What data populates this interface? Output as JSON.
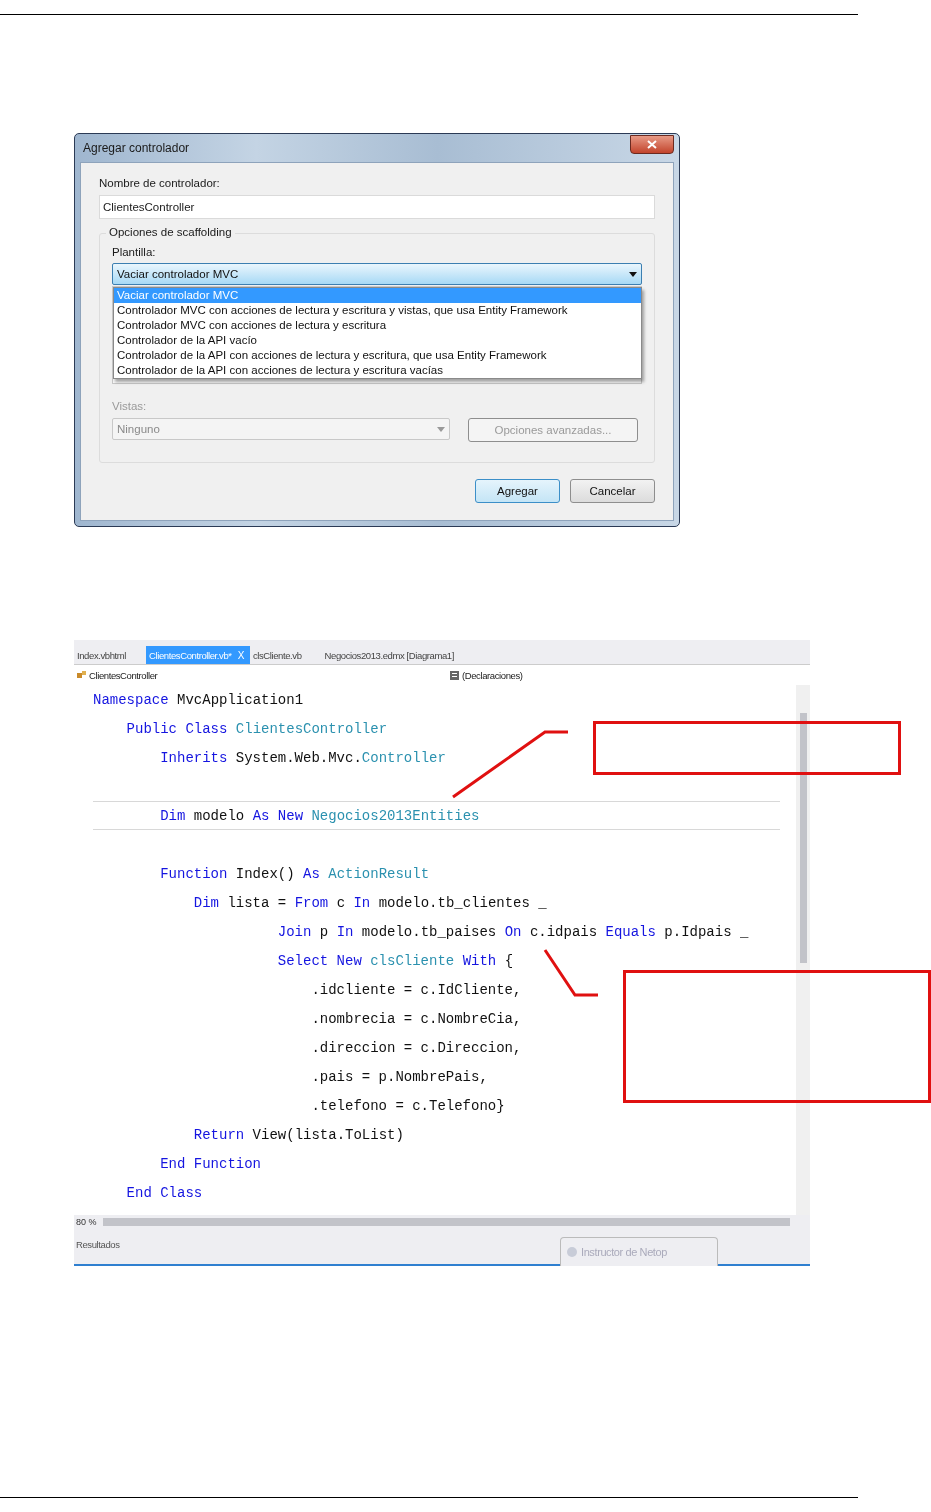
{
  "dialog": {
    "title": "Agregar controlador",
    "name_label": "Nombre de controlador:",
    "name_value": "ClientesController",
    "group_title": "Opciones de scaffolding",
    "template_label": "Plantilla:",
    "template_value": "Vaciar controlador MVC",
    "template_options": [
      {
        "label": "Vaciar controlador MVC",
        "selected": true
      },
      {
        "label": "Controlador MVC con acciones de lectura y escritura y vistas, que usa Entity Framework",
        "selected": false
      },
      {
        "label": "Controlador MVC con acciones de lectura y escritura",
        "selected": false
      },
      {
        "label": "Controlador de la API vacío",
        "selected": false
      },
      {
        "label": "Controlador de la API con acciones de lectura y escritura, que usa Entity Framework",
        "selected": false
      },
      {
        "label": "Controlador de la API con acciones de lectura y escritura vacías",
        "selected": false
      }
    ],
    "views_label": "Vistas:",
    "views_value": "Ninguno",
    "views_disabled": true,
    "advanced_button": {
      "label": "Opciones avanzadas...",
      "disabled": true
    },
    "buttons": [
      {
        "label": "Agregar",
        "default": true
      },
      {
        "label": "Cancelar",
        "default": false
      }
    ]
  },
  "editor": {
    "tabs": [
      {
        "label": "Index.vbhtml",
        "selected": false
      },
      {
        "label": "ClientesController.vb*",
        "selected": true,
        "close": "X"
      },
      {
        "label": "clsCliente.vb",
        "selected": false
      },
      {
        "label": "Negocios2013.edmx [Diagrama1]",
        "selected": false
      }
    ],
    "class_dropdown": "ClientesController",
    "member_dropdown": "(Declaraciones)",
    "code": [
      {
        "highlighted": false,
        "tokens": [
          {
            "kind": "kw",
            "text": "Namespace"
          },
          {
            "kind": "plain",
            "text": " MvcApplication1"
          }
        ],
        "children": [
          {
            "highlighted": false,
            "tokens": [
              {
                "kind": "kw",
                "text": "Public Class"
              },
              {
                "kind": "type",
                "text": " ClientesController"
              }
            ],
            "children": [
              {
                "highlighted": false,
                "tokens": [
                  {
                    "kind": "kw",
                    "text": "Inherits"
                  },
                  {
                    "kind": "plain",
                    "text": " System.Web.Mvc."
                  },
                  {
                    "kind": "type",
                    "text": "Controller"
                  }
                ]
              },
              {
                "highlighted": false
              },
              {
                "highlighted": true,
                "tokens": [
                  {
                    "kind": "kw",
                    "text": "Dim"
                  },
                  {
                    "kind": "plain",
                    "text": " modelo "
                  },
                  {
                    "kind": "kw",
                    "text": "As New"
                  },
                  {
                    "kind": "type",
                    "text": " Negocios2013Entities"
                  }
                ]
              },
              {
                "highlighted": false
              },
              {
                "highlighted": false,
                "tokens": [
                  {
                    "kind": "kw",
                    "text": "Function"
                  },
                  {
                    "kind": "plain",
                    "text": " Index() "
                  },
                  {
                    "kind": "kw",
                    "text": "As"
                  },
                  {
                    "kind": "type",
                    "text": " ActionResult"
                  }
                ],
                "children": [
                  {
                    "highlighted": false,
                    "tokens": [
                      {
                        "kind": "kw",
                        "text": "Dim"
                      },
                      {
                        "kind": "plain",
                        "text": " lista = "
                      },
                      {
                        "kind": "kw",
                        "text": "From"
                      },
                      {
                        "kind": "plain",
                        "text": " c "
                      },
                      {
                        "kind": "kw",
                        "text": "In"
                      },
                      {
                        "kind": "plain",
                        "text": " modelo.tb_clientes _"
                      }
                    ],
                    "children": [
                      {
                        "highlighted": false,
                        "tokens": [
                          {
                            "kind": "kw",
                            "text": "Join"
                          },
                          {
                            "kind": "plain",
                            "text": " p "
                          },
                          {
                            "kind": "kw",
                            "text": "In"
                          },
                          {
                            "kind": "plain",
                            "text": " modelo.tb_paises "
                          },
                          {
                            "kind": "kw",
                            "text": "On"
                          },
                          {
                            "kind": "plain",
                            "text": " c.idpais "
                          },
                          {
                            "kind": "kw",
                            "text": "Equals"
                          },
                          {
                            "kind": "plain",
                            "text": " p.Idpais _"
                          }
                        ]
                      },
                      {
                        "highlighted": false,
                        "tokens": [
                          {
                            "kind": "kw",
                            "text": "Select New"
                          },
                          {
                            "kind": "type",
                            "text": " clsCliente"
                          },
                          {
                            "kind": "kw",
                            "text": " With"
                          },
                          {
                            "kind": "plain",
                            "text": " {"
                          }
                        ],
                        "children": [
                          {
                            "highlighted": false,
                            "tokens": [
                              {
                                "kind": "plain",
                                "text": ".idcliente = c.IdCliente,"
                              }
                            ]
                          },
                          {
                            "highlighted": false,
                            "tokens": [
                              {
                                "kind": "plain",
                                "text": ".nombrecia = c.NombreCia,"
                              }
                            ]
                          },
                          {
                            "highlighted": false,
                            "tokens": [
                              {
                                "kind": "plain",
                                "text": ".direccion = c.Direccion,"
                              }
                            ]
                          },
                          {
                            "highlighted": false,
                            "tokens": [
                              {
                                "kind": "plain",
                                "text": ".pais = p.NombrePais,"
                              }
                            ]
                          },
                          {
                            "highlighted": false,
                            "tokens": [
                              {
                                "kind": "plain",
                                "text": ".telefono = c.Telefono}"
                              }
                            ]
                          }
                        ]
                      }
                    ]
                  },
                  {
                    "highlighted": false,
                    "tokens": [
                      {
                        "kind": "kw",
                        "text": "Return"
                      },
                      {
                        "kind": "plain",
                        "text": " View(lista.ToList)"
                      }
                    ]
                  }
                ]
              },
              {
                "highlighted": false,
                "tokens": [
                  {
                    "kind": "kw",
                    "text": "End Function"
                  }
                ]
              }
            ]
          },
          {
            "highlighted": false,
            "tokens": [
              {
                "kind": "kw",
                "text": "End Class"
              }
            ]
          }
        ]
      }
    ],
    "zoom": "80 %",
    "output_panel": "Resultados",
    "floating_tab": "Instructor de Netop"
  }
}
